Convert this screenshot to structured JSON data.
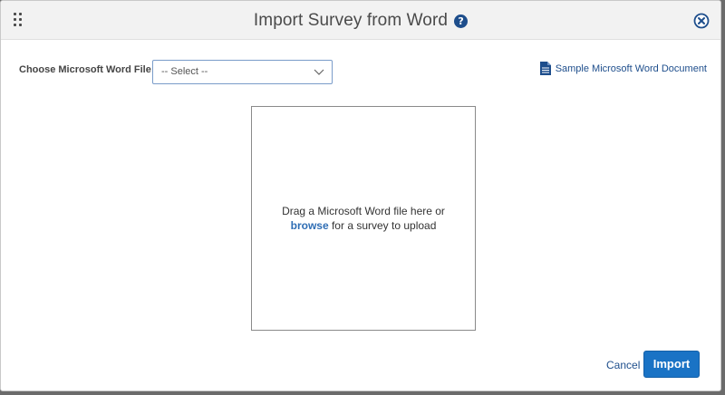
{
  "dialog": {
    "title": "Import Survey from Word",
    "help_icon": "question-circle-icon",
    "help_glyph": "?",
    "close_icon": "close-circle-icon"
  },
  "form": {
    "file_label": "Choose Microsoft Word File:",
    "file_select_value": "-- Select --",
    "sample_link": "Sample Microsoft Word Document",
    "sample_icon": "word-document-icon"
  },
  "dropzone": {
    "line1": "Drag a Microsoft Word file here or",
    "browse_label": "browse",
    "line2_rest": " for a survey to upload"
  },
  "footer": {
    "cancel_label": "Cancel",
    "import_label": "Import"
  },
  "colors": {
    "accent": "#1e4e8c",
    "primary_button": "#1a73c5",
    "header_bg": "#f2f2f2"
  }
}
